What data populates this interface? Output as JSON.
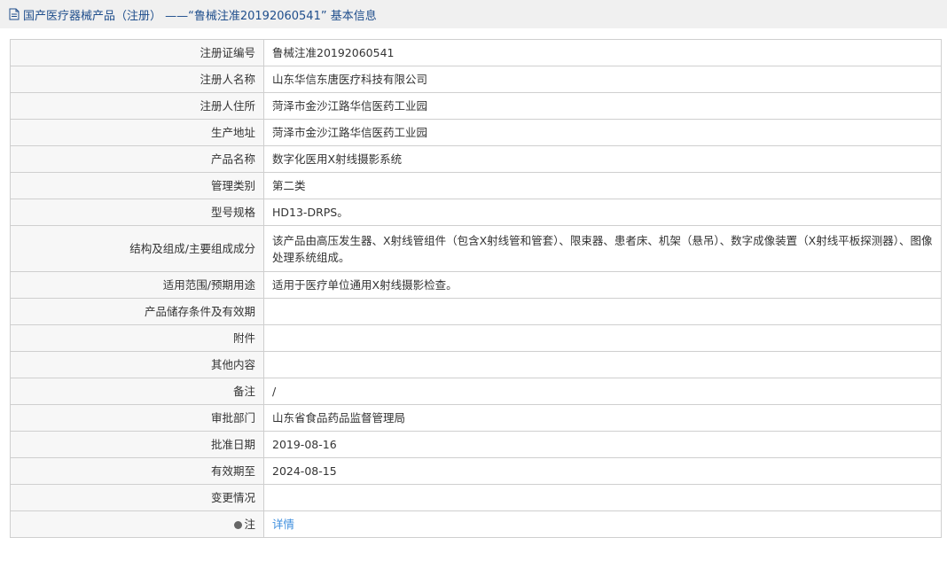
{
  "header": {
    "title": "国产医疗器械产品（注册）  ——“鲁械注准20192060541” 基本信息"
  },
  "rows": [
    {
      "label": "注册证编号",
      "value": "鲁械注准20192060541"
    },
    {
      "label": "注册人名称",
      "value": "山东华信东唐医疗科技有限公司"
    },
    {
      "label": "注册人住所",
      "value": "菏泽市金沙江路华信医药工业园"
    },
    {
      "label": "生产地址",
      "value": "菏泽市金沙江路华信医药工业园"
    },
    {
      "label": "产品名称",
      "value": "数字化医用X射线摄影系统"
    },
    {
      "label": "管理类别",
      "value": "第二类"
    },
    {
      "label": "型号规格",
      "value": "HD13-DRPS。"
    },
    {
      "label": "结构及组成/主要组成成分",
      "value": "该产品由高压发生器、X射线管组件（包含X射线管和管套）、限束器、患者床、机架（悬吊）、数字成像装置（X射线平板探测器）、图像处理系统组成。"
    },
    {
      "label": "适用范围/预期用途",
      "value": "适用于医疗单位通用X射线摄影检查。"
    },
    {
      "label": "产品储存条件及有效期",
      "value": ""
    },
    {
      "label": "附件",
      "value": ""
    },
    {
      "label": "其他内容",
      "value": ""
    },
    {
      "label": "备注",
      "value": "/"
    },
    {
      "label": "审批部门",
      "value": "山东省食品药品监督管理局"
    },
    {
      "label": "批准日期",
      "value": "2019-08-16"
    },
    {
      "label": "有效期至",
      "value": "2024-08-15"
    },
    {
      "label": "变更情况",
      "value": ""
    },
    {
      "label": "注",
      "value": "详情"
    }
  ],
  "icons": {
    "title_icon": "document-icon",
    "note_icon": "note-icon"
  },
  "colors": {
    "title_text": "#1f4e8c",
    "link": "#3c8ede",
    "label_bg": "#f7f7f7",
    "border": "#cfcfcf"
  }
}
